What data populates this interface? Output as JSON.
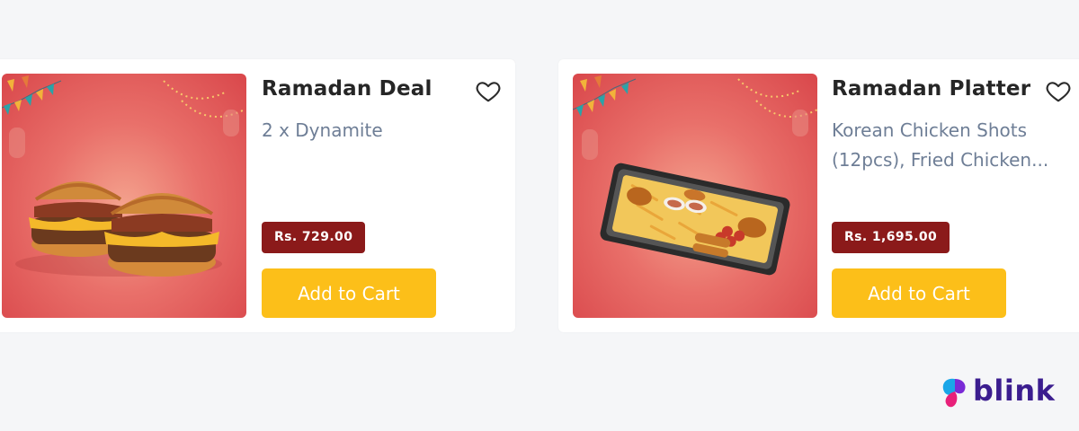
{
  "products": [
    {
      "title": "Ramadan Deal",
      "description_lines": [
        "2 x Dynamite"
      ],
      "price": "Rs. 729.00",
      "cta_label": "Add to Cart",
      "image": "two-burgers-image"
    },
    {
      "title": "Ramadan Platter",
      "description_lines": [
        "Korean Chicken Shots",
        "(12pcs), Fried Chicken..."
      ],
      "price": "Rs. 1,695.00",
      "cta_label": "Add to Cart",
      "image": "platter-tray-image"
    }
  ],
  "brand": {
    "name": "blink"
  },
  "colors": {
    "price_badge": "#8b1a1a",
    "cta": "#fcbf19",
    "title": "#262626",
    "description": "#6e7e96",
    "brand_text": "#3b1d8f",
    "page_bg": "#f5f6f8"
  },
  "icons": {
    "favorite": "heart-outline-icon"
  }
}
